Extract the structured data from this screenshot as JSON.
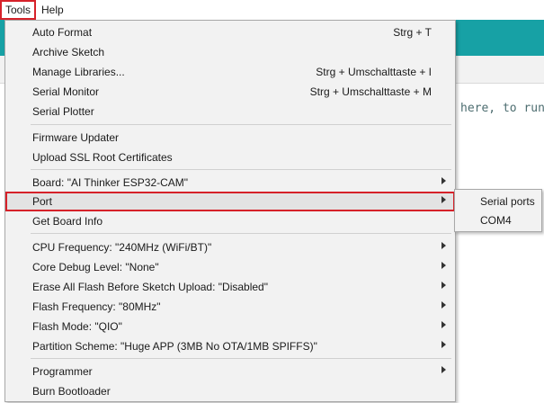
{
  "menubar": {
    "tools": "Tools",
    "help": "Help"
  },
  "background": {
    "code_snippet": "here, to run"
  },
  "tools_menu": {
    "items": [
      {
        "label": "Auto Format",
        "shortcut": "Strg + T"
      },
      {
        "label": "Archive Sketch",
        "shortcut": ""
      },
      {
        "label": "Manage Libraries...",
        "shortcut": "Strg + Umschalttaste + I"
      },
      {
        "label": "Serial Monitor",
        "shortcut": "Strg + Umschalttaste + M"
      },
      {
        "label": "Serial Plotter",
        "shortcut": ""
      },
      {
        "label": "Firmware Updater",
        "shortcut": ""
      },
      {
        "label": "Upload SSL Root Certificates",
        "shortcut": ""
      },
      {
        "label": "Board: \"AI Thinker ESP32-CAM\"",
        "shortcut": ""
      },
      {
        "label": "Port",
        "shortcut": ""
      },
      {
        "label": "Get Board Info",
        "shortcut": ""
      },
      {
        "label": "CPU Frequency: \"240MHz (WiFi/BT)\"",
        "shortcut": ""
      },
      {
        "label": "Core Debug Level: \"None\"",
        "shortcut": ""
      },
      {
        "label": "Erase All Flash Before Sketch Upload: \"Disabled\"",
        "shortcut": ""
      },
      {
        "label": "Flash Frequency: \"80MHz\"",
        "shortcut": ""
      },
      {
        "label": "Flash Mode: \"QIO\"",
        "shortcut": ""
      },
      {
        "label": "Partition Scheme: \"Huge APP (3MB No OTA/1MB SPIFFS)\"",
        "shortcut": ""
      },
      {
        "label": "Programmer",
        "shortcut": ""
      },
      {
        "label": "Burn Bootloader",
        "shortcut": ""
      }
    ]
  },
  "port_submenu": {
    "header": "Serial ports",
    "items": [
      "COM4"
    ]
  },
  "colors": {
    "highlight_border": "#d6222a",
    "toolbar": "#17a1a5",
    "menu_bg": "#f2f2f2"
  }
}
